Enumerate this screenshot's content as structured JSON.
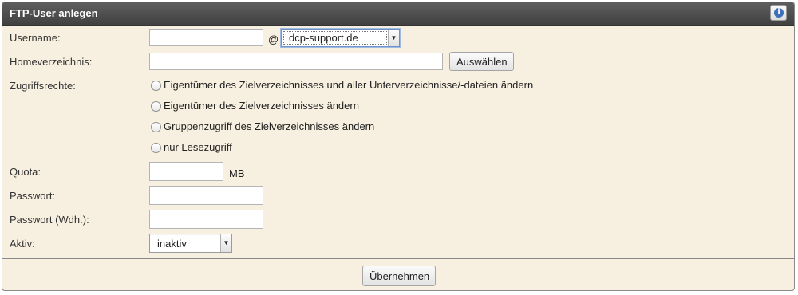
{
  "panel": {
    "title": "FTP-User anlegen",
    "info_icon": "info-icon"
  },
  "form": {
    "username": {
      "label": "Username:",
      "value": "",
      "separator": "@",
      "domain_selected": "dcp-support.de"
    },
    "home": {
      "label": "Homeverzeichnis:",
      "value": "",
      "button_label": "Auswählen"
    },
    "access": {
      "label": "Zugriffsrechte:",
      "options": [
        "Eigentümer des Zielverzeichnisses und aller Unterverzeichnisse/-dateien ändern",
        "Eigentümer des Zielverzeichnisses ändern",
        "Gruppenzugriff des Zielverzeichnisses ändern",
        "nur Lesezugriff"
      ]
    },
    "quota": {
      "label": "Quota:",
      "value": "",
      "unit": "MB"
    },
    "password": {
      "label": "Passwort:",
      "value": ""
    },
    "password_repeat": {
      "label": "Passwort (Wdh.):",
      "value": ""
    },
    "active": {
      "label": "Aktiv:",
      "selected": "inaktiv"
    }
  },
  "footer": {
    "submit_label": "Übernehmen"
  },
  "colors": {
    "panel_bg": "#f7efdf",
    "header_bg": "#4a4a4a",
    "focus_border": "#6d93c9"
  }
}
